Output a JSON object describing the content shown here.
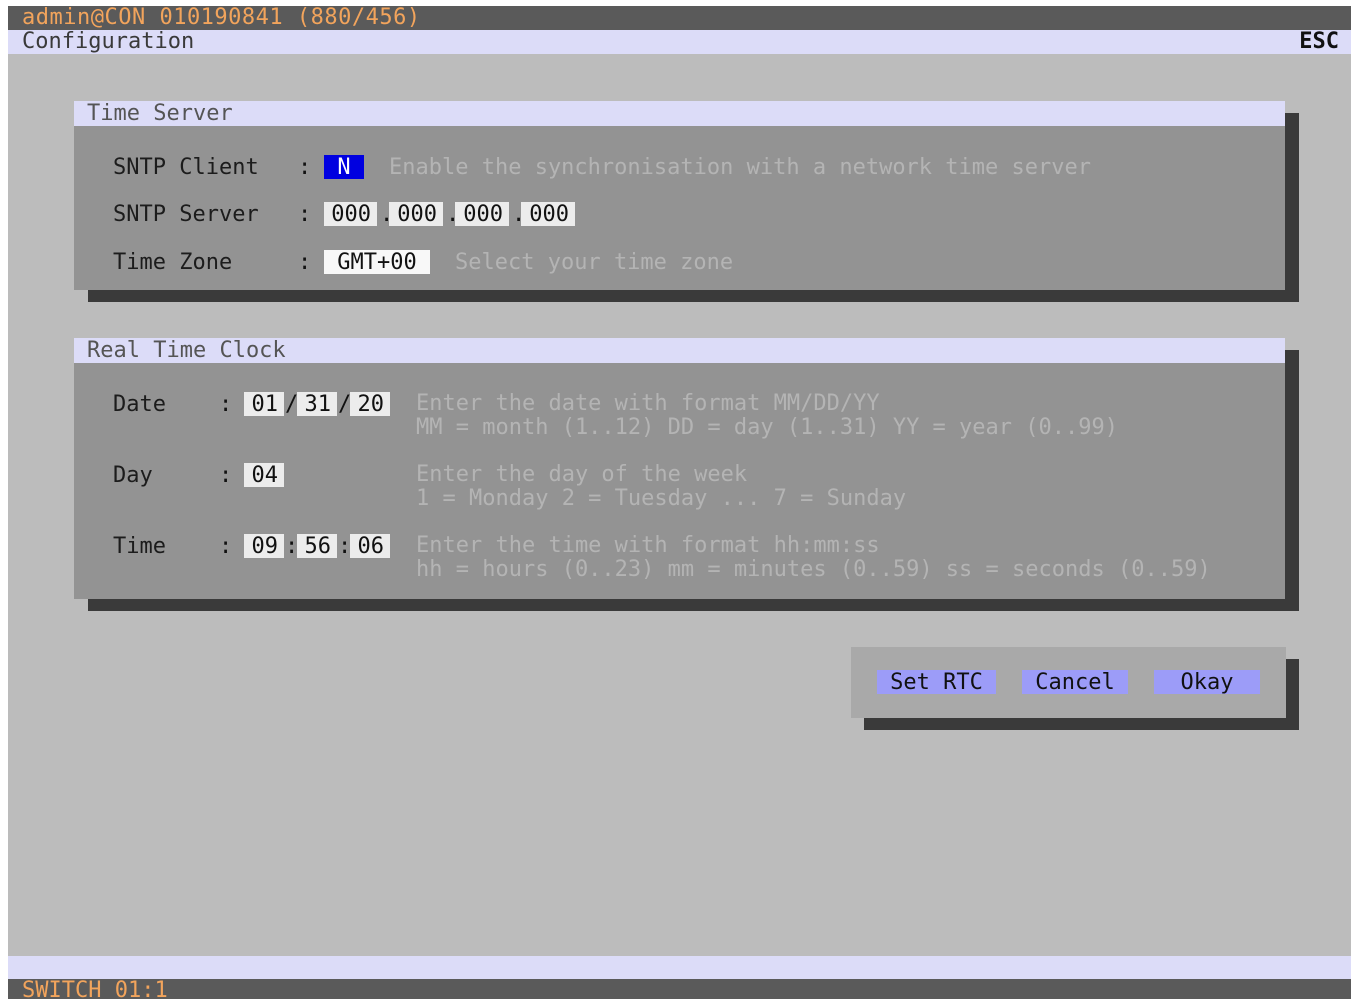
{
  "titlebar": {
    "text": "admin@CON 010190841 (880/456)"
  },
  "menubar": {
    "title": "Configuration",
    "esc_label": "ESC"
  },
  "time_server": {
    "heading": "Time Server",
    "sntp_client": {
      "label": "SNTP Client",
      "colon": ":",
      "value": "N",
      "hint": "Enable the synchronisation with a network time server"
    },
    "sntp_server": {
      "label": "SNTP Server",
      "colon": ":",
      "octets": [
        "000",
        "000",
        "000",
        "000"
      ],
      "dot": "."
    },
    "time_zone": {
      "label": "Time Zone",
      "colon": ":",
      "value": "GMT+00",
      "hint": "Select your time zone"
    }
  },
  "rtc": {
    "heading": "Real Time Clock",
    "date": {
      "label": "Date",
      "colon": ":",
      "mm": "01",
      "dd": "31",
      "yy": "20",
      "sep": "/",
      "hint1": "Enter the date with format MM/DD/YY",
      "hint2": "MM = month (1..12) DD = day (1..31) YY = year (0..99)"
    },
    "day": {
      "label": "Day",
      "colon": ":",
      "value": "04",
      "hint1": "Enter the day of the week",
      "hint2": "1 = Monday 2 = Tuesday ... 7 = Sunday"
    },
    "time": {
      "label": "Time",
      "colon": ":",
      "hh": "09",
      "mm": "56",
      "ss": "06",
      "sep": ":",
      "hint1": "Enter the time with format hh:mm:ss",
      "hint2": "hh = hours (0..23) mm = minutes (0..59) ss = seconds (0..59)"
    }
  },
  "buttons": {
    "set_rtc": "Set RTC",
    "cancel": "Cancel",
    "okay": "Okay"
  },
  "status": {
    "text": "SWITCH 01:1"
  },
  "colors": {
    "title_text": "#f2a45c",
    "bar_light": "#dcdcf8",
    "button": "#9c9cf8",
    "selected_field": "#0000e0"
  }
}
